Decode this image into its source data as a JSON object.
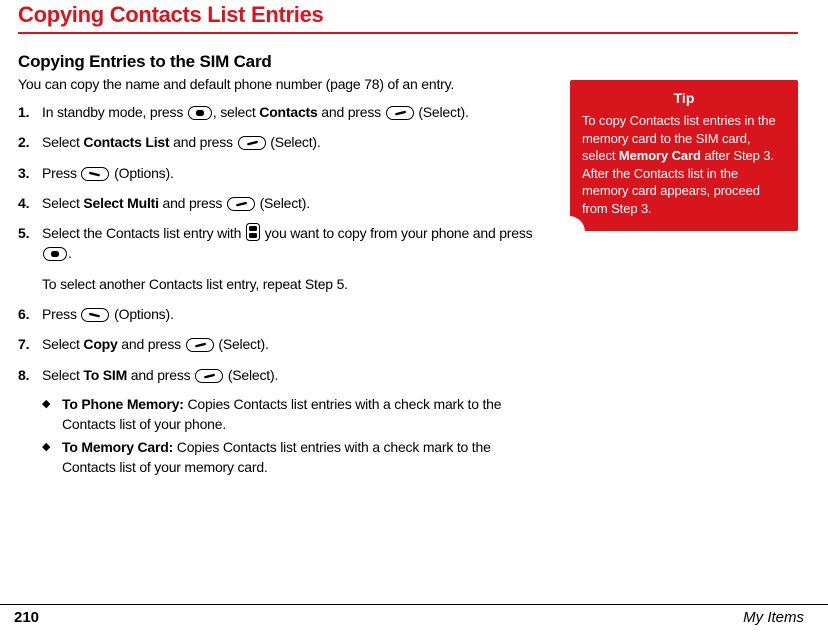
{
  "title": "Copying Contacts List Entries",
  "subheading": "Copying Entries to the SIM Card",
  "intro": "You can copy the name and default phone number (page 78) of an entry.",
  "steps": [
    {
      "pre": "In standby mode, press ",
      "icon1": "center-key",
      "mid1": ", select ",
      "bold1": "Contacts",
      "mid2": " and press ",
      "icon2": "left-softkey",
      "post": " (Select)."
    },
    {
      "pre": "Select ",
      "bold1": "Contacts List",
      "mid1": " and press ",
      "icon1": "left-softkey",
      "post": " (Select)."
    },
    {
      "pre": "Press ",
      "icon1": "right-softkey",
      "post": " (Options)."
    },
    {
      "pre": "Select ",
      "bold1": "Select Multi",
      "mid1": " and press ",
      "icon1": "left-softkey",
      "post": " (Select)."
    },
    {
      "pre": "Select the Contacts list entry with ",
      "icon1": "nav-updown",
      "mid1": " you want to copy from your phone and press ",
      "icon2": "center-key",
      "post": ".",
      "sub": "To select another Contacts list entry, repeat Step 5."
    },
    {
      "pre": "Press ",
      "icon1": "right-softkey",
      "post": " (Options)."
    },
    {
      "pre": "Select ",
      "bold1": "Copy",
      "mid1": " and press ",
      "icon1": "left-softkey",
      "post": " (Select)."
    },
    {
      "pre": "Select ",
      "bold1": "To SIM",
      "mid1": " and press ",
      "icon1": "left-softkey",
      "post": " (Select)."
    }
  ],
  "bullets": [
    {
      "bold": "To Phone Memory:",
      "text": " Copies Contacts list entries with a check mark to the Contacts list of your phone."
    },
    {
      "bold": "To Memory Card:",
      "text": " Copies Contacts list entries with a check mark to the Contacts list of your memory card."
    }
  ],
  "tip": {
    "title": "Tip",
    "pre": "To copy Contacts list entries in the memory card to the SIM card, select ",
    "bold": "Memory Card",
    "post": " after Step 3. After the Contacts list in the memory card appears, proceed from Step 3."
  },
  "footer": {
    "pageNumber": "210",
    "section": "My Items"
  }
}
